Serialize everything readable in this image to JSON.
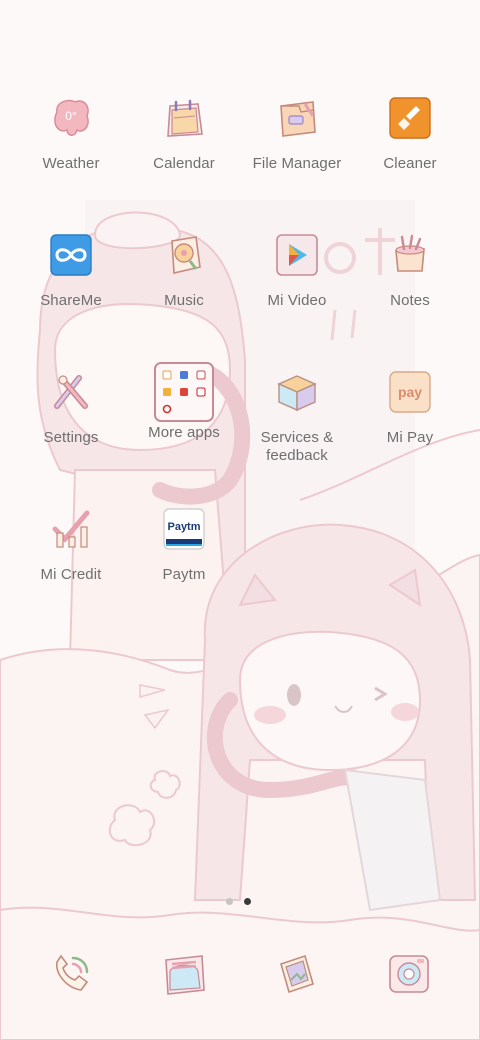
{
  "apps": [
    {
      "label": "Weather",
      "icon": "weather-icon"
    },
    {
      "label": "Calendar",
      "icon": "calendar-icon"
    },
    {
      "label": "File Manager",
      "icon": "file-manager-icon"
    },
    {
      "label": "Cleaner",
      "icon": "cleaner-icon"
    },
    {
      "label": "ShareMe",
      "icon": "shareme-icon"
    },
    {
      "label": "Music",
      "icon": "music-icon"
    },
    {
      "label": "Mi Video",
      "icon": "mi-video-icon"
    },
    {
      "label": "Notes",
      "icon": "notes-icon"
    },
    {
      "label": "Settings",
      "icon": "settings-icon"
    },
    {
      "label": "More apps",
      "icon": "more-apps-folder-icon"
    },
    {
      "label": "Services &\nfeedback",
      "icon": "services-feedback-icon"
    },
    {
      "label": "Mi Pay",
      "icon": "mi-pay-icon"
    },
    {
      "label": "Mi Credit",
      "icon": "mi-credit-icon"
    },
    {
      "label": "Paytm",
      "icon": "paytm-icon"
    }
  ],
  "weather_badge": "0°",
  "mi_pay_badge": "pay",
  "paytm_badge": "Paytm",
  "page_indicator": {
    "count": 2,
    "active": 1
  },
  "dock": [
    {
      "icon": "phone-icon"
    },
    {
      "icon": "messages-icon"
    },
    {
      "icon": "browser-icon"
    },
    {
      "icon": "camera-icon"
    }
  ],
  "colors": {
    "label": "#6f6f6f",
    "accent_pink": "#e8a8b0",
    "shareme_blue": "#3f9be6",
    "cleaner_orange": "#f0932c"
  }
}
